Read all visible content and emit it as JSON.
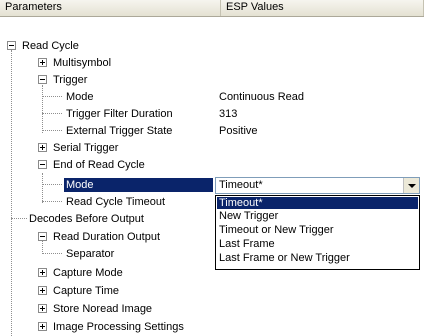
{
  "header": {
    "col_parameters": "Parameters",
    "col_values": "ESP Values"
  },
  "tree": {
    "read_cycle": "Read Cycle",
    "multisymbol": "Multisymbol",
    "trigger": "Trigger",
    "trigger_mode": "Mode",
    "trigger_mode_value": "Continuous Read",
    "trigger_filter_duration": "Trigger Filter Duration",
    "trigger_filter_duration_value": "313",
    "external_trigger_state": "External Trigger State",
    "external_trigger_state_value": "Positive",
    "serial_trigger": "Serial Trigger",
    "end_of_read_cycle": "End of Read Cycle",
    "end_mode": "Mode",
    "read_cycle_timeout": "Read Cycle Timeout",
    "decodes_before_output": "Decodes Before Output",
    "read_duration_output": "Read Duration Output",
    "separator": "Separator",
    "capture_mode": "Capture Mode",
    "capture_time": "Capture Time",
    "store_noread_image": "Store Noread Image",
    "image_processing_settings": "Image Processing Settings"
  },
  "mode_combo": {
    "selected": "Timeout*",
    "options": [
      "Timeout*",
      "New Trigger",
      "Timeout or New Trigger",
      "Last Frame",
      "Last Frame or New Trigger"
    ],
    "highlighted_index": 0
  },
  "colors": {
    "selection": "#0a246a",
    "header_bg": "#ece9d8",
    "combo_border": "#7f9db9"
  },
  "icons": {
    "expanded": "minus-box-icon",
    "collapsed": "plus-box-icon",
    "dropdown": "chevron-down-icon"
  }
}
